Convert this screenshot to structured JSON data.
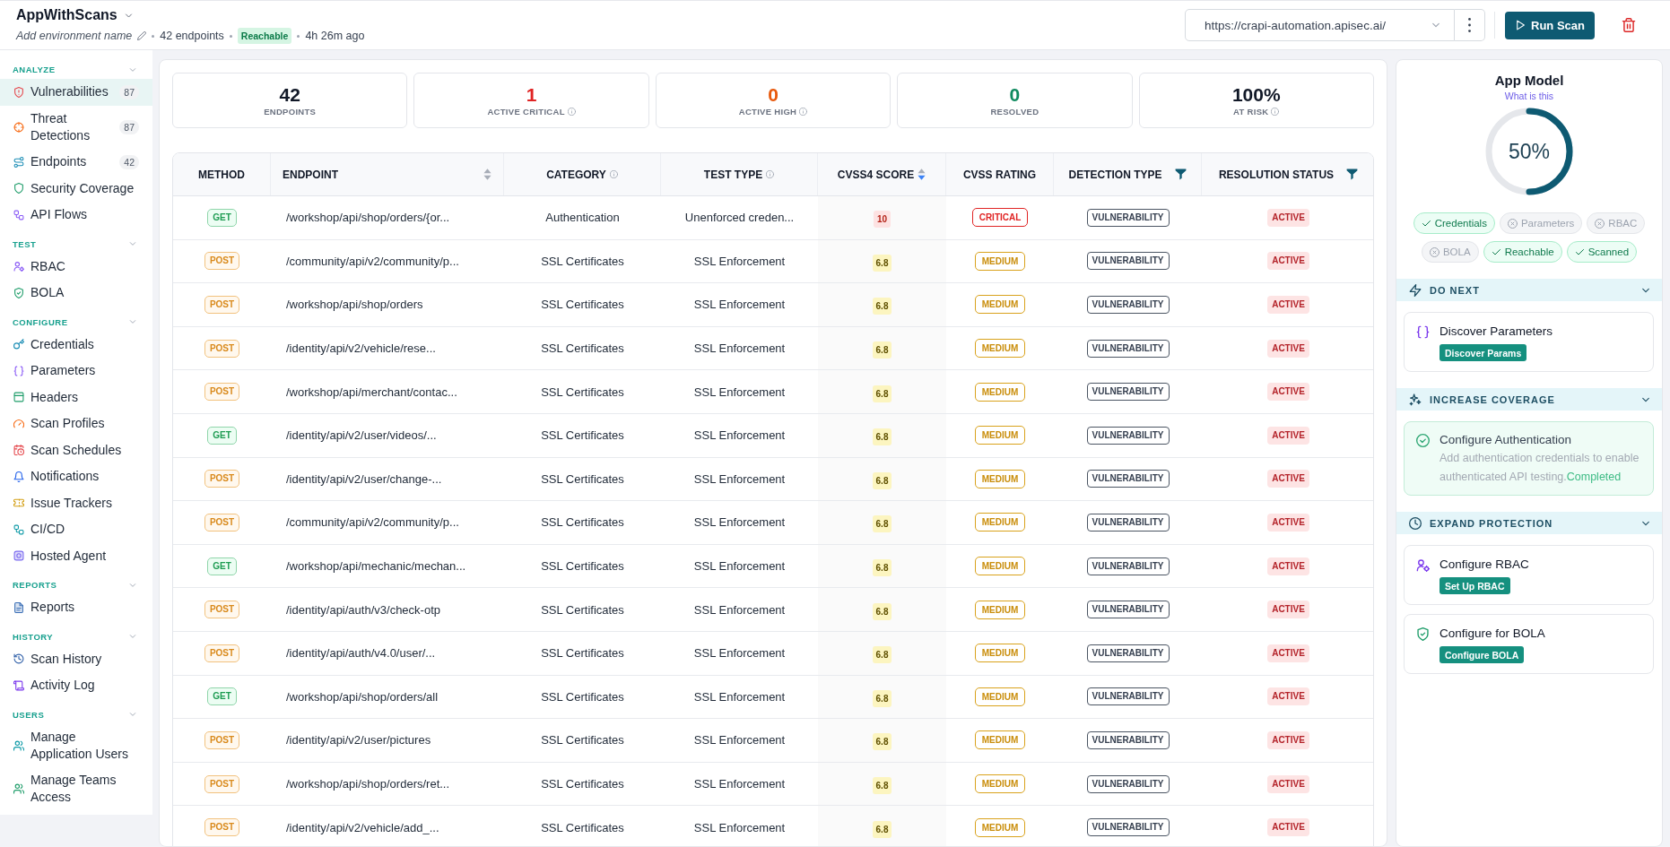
{
  "header": {
    "title": "AppWithScans",
    "environment": "Add environment name",
    "endpoints": "42 endpoints",
    "status": "Reachable",
    "updated": "4h 26m ago",
    "url": "https://crapi-automation.apisec.ai/",
    "run_button": "Run Scan"
  },
  "sidebar": {
    "sections": [
      {
        "title": "ANALYZE",
        "expanded": true,
        "items": [
          {
            "label": "Vulnerabilities",
            "count": "87",
            "selected": true
          },
          {
            "label": "Threat Detections",
            "count": "87",
            "selected": false
          },
          {
            "label": "Endpoints",
            "count": "42",
            "selected": false
          },
          {
            "label": "Security Coverage",
            "selected": false
          },
          {
            "label": "API Flows",
            "selected": false
          }
        ]
      },
      {
        "title": "TEST",
        "expanded": true,
        "items": [
          {
            "label": "RBAC",
            "selected": false
          },
          {
            "label": "BOLA",
            "selected": false
          }
        ]
      },
      {
        "title": "CONFIGURE",
        "expanded": true,
        "items": [
          {
            "label": "Credentials",
            "selected": false
          },
          {
            "label": "Parameters",
            "selected": false
          },
          {
            "label": "Headers",
            "selected": false
          },
          {
            "label": "Scan Profiles",
            "selected": false
          },
          {
            "label": "Scan Schedules",
            "selected": false
          },
          {
            "label": "Notifications",
            "selected": false
          },
          {
            "label": "Issue Trackers",
            "selected": false
          },
          {
            "label": "CI/CD",
            "selected": false
          },
          {
            "label": "Hosted Agent",
            "selected": false
          }
        ]
      },
      {
        "title": "REPORTS",
        "expanded": true,
        "items": [
          {
            "label": "Reports",
            "selected": false
          }
        ]
      },
      {
        "title": "HISTORY",
        "expanded": true,
        "items": [
          {
            "label": "Scan History",
            "selected": false
          },
          {
            "label": "Activity Log",
            "selected": false
          }
        ]
      },
      {
        "title": "USERS",
        "expanded": true,
        "items": [
          {
            "label": "Manage Application Users",
            "selected": false
          },
          {
            "label": "Manage Teams Access",
            "selected": false
          }
        ]
      }
    ]
  },
  "stats": [
    {
      "value": "42",
      "label": "ENDPOINTS",
      "color": "#111827",
      "info": false
    },
    {
      "value": "1",
      "label": "ACTIVE CRITICAL",
      "color": "#e02424",
      "info": true
    },
    {
      "value": "0",
      "label": "ACTIVE HIGH",
      "color": "#e8590c",
      "info": true
    },
    {
      "value": "0",
      "label": "RESOLVED",
      "color": "#0f8a5f",
      "info": false
    },
    {
      "value": "100%",
      "label": "AT RISK",
      "color": "#111827",
      "info": true
    }
  ],
  "table": {
    "columns": [
      {
        "label": "METHOD",
        "sortable": false,
        "info": false,
        "filter": false
      },
      {
        "label": "ENDPOINT",
        "sortable": true,
        "sort_descending": false,
        "info": false,
        "filter": false
      },
      {
        "label": "CATEGORY",
        "sortable": false,
        "info": true,
        "filter": false
      },
      {
        "label": "TEST TYPE",
        "sortable": false,
        "info": true,
        "filter": false
      },
      {
        "label": "CVSS4 SCORE",
        "sortable": true,
        "sort_descending": true,
        "info": false,
        "filter": false
      },
      {
        "label": "CVSS RATING",
        "sortable": false,
        "info": false,
        "filter": false
      },
      {
        "label": "DETECTION TYPE",
        "sortable": false,
        "info": false,
        "filter": true
      },
      {
        "label": "RESOLUTION STATUS",
        "sortable": false,
        "info": false,
        "filter": true
      }
    ],
    "rows": [
      {
        "method": {
          "label": "GET",
          "kind": "get"
        },
        "endpoint": "/workshop/api/shop/orders/{or...",
        "category": "Authentication",
        "test_type": "Unenforced creden...",
        "score": "10",
        "rating": {
          "label": "CRITICAL",
          "kind": "critical"
        },
        "detection_type": "VULNERABILITY",
        "status": "ACTIVE"
      },
      {
        "method": {
          "label": "POST",
          "kind": "post"
        },
        "endpoint": "/community/api/v2/community/p...",
        "category": "SSL Certificates",
        "test_type": "SSL Enforcement",
        "score": "6.8",
        "rating": {
          "label": "MEDIUM",
          "kind": "medium"
        },
        "detection_type": "VULNERABILITY",
        "status": "ACTIVE"
      },
      {
        "method": {
          "label": "POST",
          "kind": "post"
        },
        "endpoint": "/workshop/api/shop/orders",
        "category": "SSL Certificates",
        "test_type": "SSL Enforcement",
        "score": "6.8",
        "rating": {
          "label": "MEDIUM",
          "kind": "medium"
        },
        "detection_type": "VULNERABILITY",
        "status": "ACTIVE"
      },
      {
        "method": {
          "label": "POST",
          "kind": "post"
        },
        "endpoint": "/identity/api/v2/vehicle/rese...",
        "category": "SSL Certificates",
        "test_type": "SSL Enforcement",
        "score": "6.8",
        "rating": {
          "label": "MEDIUM",
          "kind": "medium"
        },
        "detection_type": "VULNERABILITY",
        "status": "ACTIVE"
      },
      {
        "method": {
          "label": "POST",
          "kind": "post"
        },
        "endpoint": "/workshop/api/merchant/contac...",
        "category": "SSL Certificates",
        "test_type": "SSL Enforcement",
        "score": "6.8",
        "rating": {
          "label": "MEDIUM",
          "kind": "medium"
        },
        "detection_type": "VULNERABILITY",
        "status": "ACTIVE"
      },
      {
        "method": {
          "label": "GET",
          "kind": "get"
        },
        "endpoint": "/identity/api/v2/user/videos/...",
        "category": "SSL Certificates",
        "test_type": "SSL Enforcement",
        "score": "6.8",
        "rating": {
          "label": "MEDIUM",
          "kind": "medium"
        },
        "detection_type": "VULNERABILITY",
        "status": "ACTIVE"
      },
      {
        "method": {
          "label": "POST",
          "kind": "post"
        },
        "endpoint": "/identity/api/v2/user/change-...",
        "category": "SSL Certificates",
        "test_type": "SSL Enforcement",
        "score": "6.8",
        "rating": {
          "label": "MEDIUM",
          "kind": "medium"
        },
        "detection_type": "VULNERABILITY",
        "status": "ACTIVE"
      },
      {
        "method": {
          "label": "POST",
          "kind": "post"
        },
        "endpoint": "/community/api/v2/community/p...",
        "category": "SSL Certificates",
        "test_type": "SSL Enforcement",
        "score": "6.8",
        "rating": {
          "label": "MEDIUM",
          "kind": "medium"
        },
        "detection_type": "VULNERABILITY",
        "status": "ACTIVE"
      },
      {
        "method": {
          "label": "GET",
          "kind": "get"
        },
        "endpoint": "/workshop/api/mechanic/mechan...",
        "category": "SSL Certificates",
        "test_type": "SSL Enforcement",
        "score": "6.8",
        "rating": {
          "label": "MEDIUM",
          "kind": "medium"
        },
        "detection_type": "VULNERABILITY",
        "status": "ACTIVE"
      },
      {
        "method": {
          "label": "POST",
          "kind": "post"
        },
        "endpoint": "/identity/api/auth/v3/check-otp",
        "category": "SSL Certificates",
        "test_type": "SSL Enforcement",
        "score": "6.8",
        "rating": {
          "label": "MEDIUM",
          "kind": "medium"
        },
        "detection_type": "VULNERABILITY",
        "status": "ACTIVE"
      },
      {
        "method": {
          "label": "POST",
          "kind": "post"
        },
        "endpoint": "/identity/api/auth/v4.0/user/...",
        "category": "SSL Certificates",
        "test_type": "SSL Enforcement",
        "score": "6.8",
        "rating": {
          "label": "MEDIUM",
          "kind": "medium"
        },
        "detection_type": "VULNERABILITY",
        "status": "ACTIVE"
      },
      {
        "method": {
          "label": "GET",
          "kind": "get"
        },
        "endpoint": "/workshop/api/shop/orders/all",
        "category": "SSL Certificates",
        "test_type": "SSL Enforcement",
        "score": "6.8",
        "rating": {
          "label": "MEDIUM",
          "kind": "medium"
        },
        "detection_type": "VULNERABILITY",
        "status": "ACTIVE"
      },
      {
        "method": {
          "label": "POST",
          "kind": "post"
        },
        "endpoint": "/identity/api/v2/user/pictures",
        "category": "SSL Certificates",
        "test_type": "SSL Enforcement",
        "score": "6.8",
        "rating": {
          "label": "MEDIUM",
          "kind": "medium"
        },
        "detection_type": "VULNERABILITY",
        "status": "ACTIVE"
      },
      {
        "method": {
          "label": "POST",
          "kind": "post"
        },
        "endpoint": "/workshop/api/shop/orders/ret...",
        "category": "SSL Certificates",
        "test_type": "SSL Enforcement",
        "score": "6.8",
        "rating": {
          "label": "MEDIUM",
          "kind": "medium"
        },
        "detection_type": "VULNERABILITY",
        "status": "ACTIVE"
      },
      {
        "method": {
          "label": "POST",
          "kind": "post"
        },
        "endpoint": "/identity/api/v2/vehicle/add_...",
        "category": "SSL Certificates",
        "test_type": "SSL Enforcement",
        "score": "6.8",
        "rating": {
          "label": "MEDIUM",
          "kind": "medium"
        },
        "detection_type": "VULNERABILITY",
        "status": "ACTIVE"
      }
    ]
  },
  "app_model": {
    "title": "App Model",
    "link": "What is this",
    "level": 0.5,
    "reading": "50%",
    "checks": [
      {
        "label": "Credentials",
        "done": true
      },
      {
        "label": "Parameters",
        "done": false
      },
      {
        "label": "RBAC",
        "done": false
      },
      {
        "label": "BOLA",
        "done": false
      },
      {
        "label": "Reachable",
        "done": true
      },
      {
        "label": "Scanned",
        "done": true
      }
    ],
    "sections": [
      {
        "title": "DO NEXT",
        "expanded": true,
        "cards": [
          {
            "title": "Discover Parameters",
            "action": "Discover Params",
            "completed": false
          }
        ]
      },
      {
        "title": "INCREASE COVERAGE",
        "expanded": true,
        "cards": [
          {
            "title": "Configure Authentication",
            "description": "Add authentication credentials to enable authenticated API testing.",
            "status": "Completed",
            "completed": true
          }
        ]
      },
      {
        "title": "EXPAND PROTECTION",
        "expanded": true,
        "cards": [
          {
            "title": "Configure RBAC",
            "action": "Set Up RBAC",
            "completed": false
          },
          {
            "title": "Configure for BOLA",
            "action": "Configure BOLA",
            "completed": false
          }
        ]
      }
    ]
  }
}
